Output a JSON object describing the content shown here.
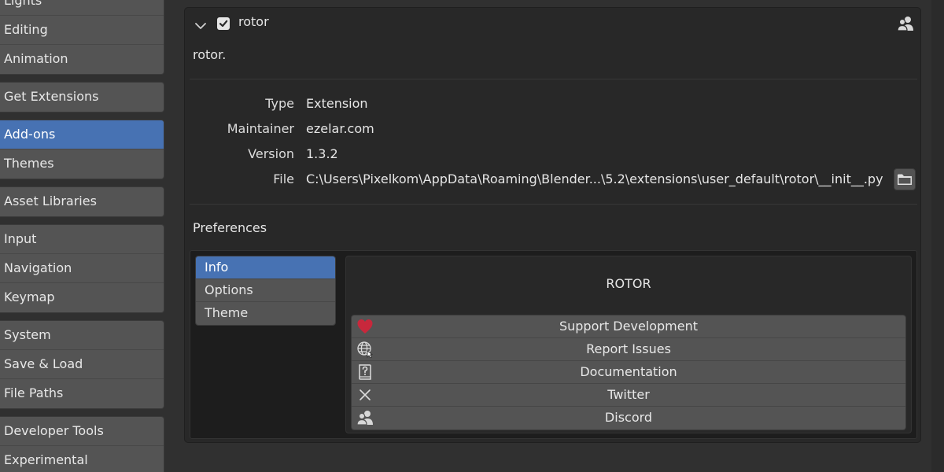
{
  "sidebar": {
    "groups": [
      [
        "Lights",
        "Editing",
        "Animation"
      ],
      [
        "Get Extensions"
      ],
      [
        "Add-ons",
        "Themes"
      ],
      [
        "Asset Libraries"
      ],
      [
        "Input",
        "Navigation",
        "Keymap"
      ],
      [
        "System",
        "Save & Load",
        "File Paths"
      ],
      [
        "Developer Tools",
        "Experimental"
      ]
    ],
    "active": "Add-ons"
  },
  "addon": {
    "name": "rotor",
    "enabled": true,
    "expanded": true,
    "description": "rotor.",
    "info": {
      "type_label": "Type",
      "type_value": "Extension",
      "maintainer_label": "Maintainer",
      "maintainer_value": "ezelar.com",
      "version_label": "Version",
      "version_value": "1.3.2",
      "file_label": "File",
      "file_value": "C:\\Users\\Pixelkom\\AppData\\Roaming\\Blender...\\5.2\\extensions\\user_default\\rotor\\__init__.py"
    }
  },
  "preferences": {
    "title": "Preferences",
    "tabs": [
      "Info",
      "Options",
      "Theme"
    ],
    "active_tab": "Info",
    "content_title": "ROTOR",
    "links": [
      {
        "label": "Support Development",
        "icon": "heart-icon"
      },
      {
        "label": "Report Issues",
        "icon": "globe-icon"
      },
      {
        "label": "Documentation",
        "icon": "help-book-icon"
      },
      {
        "label": "Twitter",
        "icon": "x-icon"
      },
      {
        "label": "Discord",
        "icon": "community-icon"
      }
    ]
  },
  "colors": {
    "accent": "#4772b3",
    "button": "#545454",
    "panel": "#282828",
    "heart": "#c8283c"
  }
}
